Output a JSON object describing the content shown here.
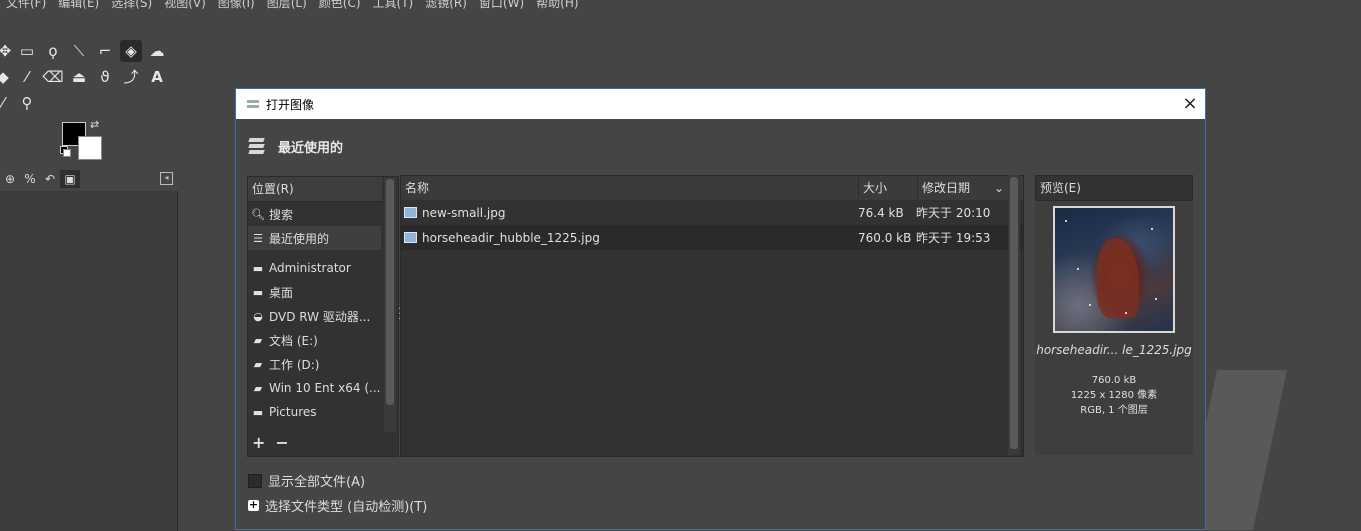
{
  "menubar": [
    "文件(F)",
    "编辑(E)",
    "选择(S)",
    "视图(V)",
    "图像(I)",
    "图层(L)",
    "颜色(C)",
    "工具(T)",
    "滤镜(R)",
    "窗口(W)",
    "帮助(H)"
  ],
  "toolbox": {
    "icons": [
      "move-icon",
      "rect-select-icon",
      "lasso-icon",
      "fuzzy-select-icon",
      "crop-icon",
      "transform-icon",
      "warp-icon",
      "bucket-fill-icon",
      "paintbrush-icon",
      "eraser-icon",
      "clone-icon",
      "smudge-icon",
      "paths-icon",
      "text-icon",
      "color-picker-icon",
      "zoom-icon"
    ],
    "fg_color": "#000000",
    "bg_color": "#ffffff"
  },
  "dialog": {
    "title": "打开图像",
    "location_title": "最近使用的",
    "places_header": "位置(R)",
    "places": [
      {
        "icon": "search-icon",
        "label": "搜索"
      },
      {
        "icon": "recent-icon",
        "label": "最近使用的"
      },
      {
        "icon": "folder-icon",
        "label": "Administrator"
      },
      {
        "icon": "folder-icon",
        "label": "桌面"
      },
      {
        "icon": "optical-drive-icon",
        "label": "DVD RW 驱动器..."
      },
      {
        "icon": "drive-icon",
        "label": "文档 (E:)"
      },
      {
        "icon": "drive-icon",
        "label": "工作 (D:)"
      },
      {
        "icon": "drive-icon",
        "label": "Win 10 Ent x64 (..."
      },
      {
        "icon": "folder-icon",
        "label": "Pictures"
      }
    ],
    "places_add": "+",
    "places_remove": "−",
    "columns": {
      "name": "名称",
      "size": "大小",
      "date": "修改日期"
    },
    "files": [
      {
        "name": "new-small.jpg",
        "size": "76.4 kB",
        "date": "昨天于 20:10"
      },
      {
        "name": "horseheadir_hubble_1225.jpg",
        "size": "760.0 kB",
        "date": "昨天于 19:53"
      }
    ],
    "preview": {
      "header": "预览(E)",
      "name": "horseheadir... le_1225.jpg",
      "size": "760.0 kB",
      "dimensions": "1225 x 1280 像素",
      "mode": "RGB, 1 个图层"
    },
    "show_all_files": "显示全部文件(A)",
    "file_type": "选择文件类型 (自动检测)(T)",
    "close": "×"
  }
}
